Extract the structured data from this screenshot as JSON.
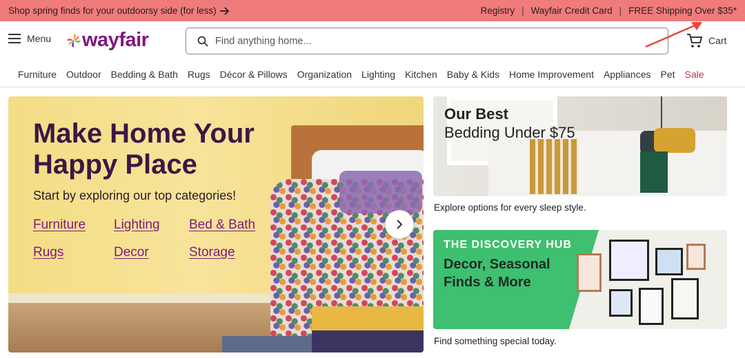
{
  "promo": {
    "left_text": "Shop spring finds for your outdoorsy side (for less)",
    "links": [
      "Registry",
      "Wayfair Credit Card",
      "FREE Shipping Over $35*"
    ]
  },
  "header": {
    "menu_label": "Menu",
    "logo_text": "wayfair",
    "search_placeholder": "Find anything home...",
    "cart_label": "Cart"
  },
  "categories": [
    "Furniture",
    "Outdoor",
    "Bedding & Bath",
    "Rugs",
    "Décor & Pillows",
    "Organization",
    "Lighting",
    "Kitchen",
    "Baby & Kids",
    "Home Improvement",
    "Appliances",
    "Pet",
    "Sale"
  ],
  "hero": {
    "title_line1": "Make Home Your",
    "title_line2": "Happy Place",
    "subtitle": "Start by exploring our top categories!",
    "links": [
      "Furniture",
      "Lighting",
      "Bed & Bath",
      "Rugs",
      "Decor",
      "Storage"
    ]
  },
  "cards": [
    {
      "title_line1": "Our Best",
      "title_line2": "Bedding Under $75",
      "caption": "Explore options for every sleep style."
    },
    {
      "kicker": "THE DISCOVERY HUB",
      "title_line1": "Decor, Seasonal",
      "title_line2": "Finds & More",
      "caption": "Find something special today."
    }
  ],
  "colors": {
    "promo_bg": "#f07b7b",
    "brand_purple": "#7f187f",
    "sale_red": "#c4314b",
    "discovery_green": "#3fbf70"
  }
}
